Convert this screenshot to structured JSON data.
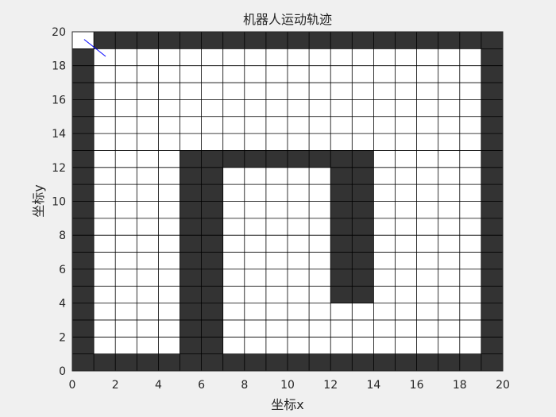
{
  "chart_data": {
    "type": "heatmap",
    "title": "机器人运动轨迹",
    "xlabel": "坐标x",
    "ylabel": "坐标y",
    "xlim": [
      0,
      20
    ],
    "ylim": [
      0,
      20
    ],
    "xticks": [
      0,
      2,
      4,
      6,
      8,
      10,
      12,
      14,
      16,
      18,
      20
    ],
    "yticks": [
      0,
      2,
      4,
      6,
      8,
      10,
      12,
      14,
      16,
      18,
      20
    ],
    "grid": true,
    "cell_size": 1,
    "colors": {
      "obstacle": "#333333",
      "free": "#ffffff",
      "grid_line": "#000000",
      "trajectory": "#0000ff",
      "background": "#f0f0f0"
    },
    "obstacle_cells": [
      [
        1,
        0
      ],
      [
        2,
        0
      ],
      [
        3,
        0
      ],
      [
        4,
        0
      ],
      [
        5,
        0
      ],
      [
        6,
        0
      ],
      [
        7,
        0
      ],
      [
        8,
        0
      ],
      [
        9,
        0
      ],
      [
        10,
        0
      ],
      [
        11,
        0
      ],
      [
        12,
        0
      ],
      [
        13,
        0
      ],
      [
        14,
        0
      ],
      [
        15,
        0
      ],
      [
        16,
        0
      ],
      [
        17,
        0
      ],
      [
        18,
        0
      ],
      [
        19,
        0
      ],
      [
        0,
        0
      ],
      [
        0,
        1
      ],
      [
        0,
        2
      ],
      [
        0,
        3
      ],
      [
        0,
        4
      ],
      [
        0,
        5
      ],
      [
        0,
        6
      ],
      [
        0,
        7
      ],
      [
        0,
        8
      ],
      [
        0,
        9
      ],
      [
        0,
        10
      ],
      [
        0,
        11
      ],
      [
        0,
        12
      ],
      [
        0,
        13
      ],
      [
        0,
        14
      ],
      [
        0,
        15
      ],
      [
        0,
        16
      ],
      [
        0,
        17
      ],
      [
        0,
        18
      ],
      [
        19,
        1
      ],
      [
        19,
        2
      ],
      [
        19,
        3
      ],
      [
        19,
        4
      ],
      [
        19,
        5
      ],
      [
        19,
        6
      ],
      [
        19,
        7
      ],
      [
        19,
        8
      ],
      [
        19,
        9
      ],
      [
        19,
        10
      ],
      [
        19,
        11
      ],
      [
        19,
        12
      ],
      [
        19,
        13
      ],
      [
        19,
        14
      ],
      [
        19,
        15
      ],
      [
        19,
        16
      ],
      [
        19,
        17
      ],
      [
        19,
        18
      ],
      [
        1,
        19
      ],
      [
        2,
        19
      ],
      [
        3,
        19
      ],
      [
        4,
        19
      ],
      [
        5,
        19
      ],
      [
        6,
        19
      ],
      [
        7,
        19
      ],
      [
        8,
        19
      ],
      [
        9,
        19
      ],
      [
        10,
        19
      ],
      [
        11,
        19
      ],
      [
        12,
        19
      ],
      [
        13,
        19
      ],
      [
        14,
        19
      ],
      [
        15,
        19
      ],
      [
        16,
        19
      ],
      [
        17,
        19
      ],
      [
        18,
        19
      ],
      [
        19,
        19
      ],
      [
        5,
        1
      ],
      [
        5,
        2
      ],
      [
        5,
        3
      ],
      [
        5,
        4
      ],
      [
        5,
        5
      ],
      [
        5,
        6
      ],
      [
        5,
        7
      ],
      [
        5,
        8
      ],
      [
        5,
        9
      ],
      [
        5,
        10
      ],
      [
        5,
        11
      ],
      [
        5,
        12
      ],
      [
        6,
        1
      ],
      [
        6,
        2
      ],
      [
        6,
        3
      ],
      [
        6,
        4
      ],
      [
        6,
        5
      ],
      [
        6,
        6
      ],
      [
        6,
        7
      ],
      [
        6,
        8
      ],
      [
        6,
        9
      ],
      [
        6,
        10
      ],
      [
        6,
        11
      ],
      [
        6,
        12
      ],
      [
        7,
        12
      ],
      [
        8,
        12
      ],
      [
        9,
        12
      ],
      [
        10,
        12
      ],
      [
        11,
        12
      ],
      [
        12,
        4
      ],
      [
        12,
        5
      ],
      [
        12,
        6
      ],
      [
        12,
        7
      ],
      [
        12,
        8
      ],
      [
        12,
        9
      ],
      [
        12,
        10
      ],
      [
        12,
        11
      ],
      [
        12,
        12
      ],
      [
        13,
        4
      ],
      [
        13,
        5
      ],
      [
        13,
        6
      ],
      [
        13,
        7
      ],
      [
        13,
        8
      ],
      [
        13,
        9
      ],
      [
        13,
        10
      ],
      [
        13,
        11
      ],
      [
        13,
        12
      ]
    ],
    "trajectory": {
      "x": [
        0.55,
        1.55
      ],
      "y": [
        19.55,
        18.55
      ]
    }
  }
}
